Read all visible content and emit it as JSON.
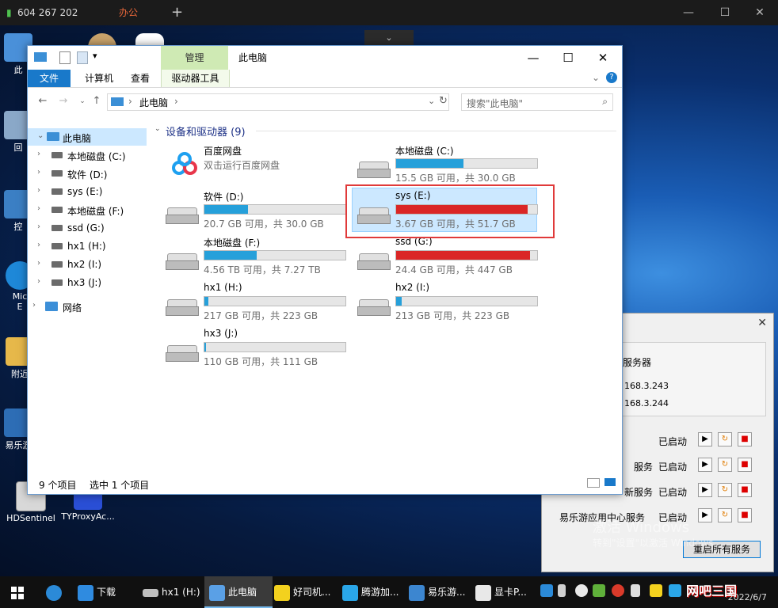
{
  "remote_bar": {
    "signal": "604 267 202",
    "tab": "办公",
    "new_tab": "+",
    "minimize": "—",
    "maximize": "☐",
    "close": "✕",
    "collapse": "⌄"
  },
  "desktop_icons": [
    {
      "label": "此"
    },
    {
      "label": "回"
    },
    {
      "label": "控"
    },
    {
      "label": "Mic\nE"
    },
    {
      "label": "附近"
    },
    {
      "label": "易乐游"
    },
    {
      "label": "HDSentinel"
    },
    {
      "label": "TYProxyAc..."
    }
  ],
  "explorer": {
    "title": "此电脑",
    "context_tab": "管理",
    "ribbon_tabs": [
      "文件",
      "计算机",
      "查看",
      "驱动器工具"
    ],
    "address_path": "此电脑",
    "search_placeholder": "搜索\"此电脑\"",
    "group_title": "设备和驱动器 (9)",
    "nav_root": "此电脑",
    "nav_drives": [
      "本地磁盘 (C:)",
      "软件 (D:)",
      "sys (E:)",
      "本地磁盘 (F:)",
      "ssd (G:)",
      "hx1 (H:)",
      "hx2 (I:)",
      "hx3 (J:)"
    ],
    "nav_network": "网络",
    "baidu": {
      "name": "百度网盘",
      "desc": "双击运行百度网盘"
    },
    "drives": [
      {
        "name": "本地磁盘 (C:)",
        "size": "15.5 GB 可用，共 30.0 GB",
        "used_pct": 48,
        "warn": false
      },
      {
        "name": "软件 (D:)",
        "size": "20.7 GB 可用，共 30.0 GB",
        "used_pct": 31,
        "warn": false
      },
      {
        "name": "sys (E:)",
        "size": "3.67 GB 可用，共 51.7 GB",
        "used_pct": 93,
        "warn": true
      },
      {
        "name": "本地磁盘 (F:)",
        "size": "4.56 TB 可用，共 7.27 TB",
        "used_pct": 37,
        "warn": false
      },
      {
        "name": "ssd (G:)",
        "size": "24.4 GB 可用，共 447 GB",
        "used_pct": 95,
        "warn": true
      },
      {
        "name": "hx1 (H:)",
        "size": "217 GB 可用，共 223 GB",
        "used_pct": 3,
        "warn": false
      },
      {
        "name": "hx2 (I:)",
        "size": "213 GB 可用，共 223 GB",
        "used_pct": 4,
        "warn": false
      },
      {
        "name": "hx3 (J:)",
        "size": "110 GB 可用，共 111 GB",
        "used_pct": 1,
        "warn": false
      }
    ],
    "status_items": "9 个项目",
    "status_selected": "选中 1 个项目"
  },
  "service_window": {
    "group_label": "服务器",
    "ip1": "168.3.243",
    "ip2": "168.3.244",
    "rows": [
      {
        "label": "",
        "status": "已启动"
      },
      {
        "label": "服务",
        "status": "已启动"
      },
      {
        "label": "新服务",
        "status": "已启动"
      },
      {
        "label": "易乐游应用中心服务",
        "status": "已启动"
      }
    ],
    "restart_button": "重启所有服务"
  },
  "activation": {
    "line1": "激活 Windows",
    "line2": "转到\"设置\"以激活 Windows。"
  },
  "taskbar": {
    "items": [
      "下载",
      "hx1 (H:)",
      "此电脑",
      "好司机...",
      "腾游加...",
      "易乐游...",
      "显卡P..."
    ],
    "brand": "网吧三国",
    "time": "2022/6/7"
  },
  "colors": {
    "accent": "#1979ca",
    "bar_blue": "#26a0da",
    "bar_red": "#da2626",
    "highlight": "#e03a3a"
  }
}
